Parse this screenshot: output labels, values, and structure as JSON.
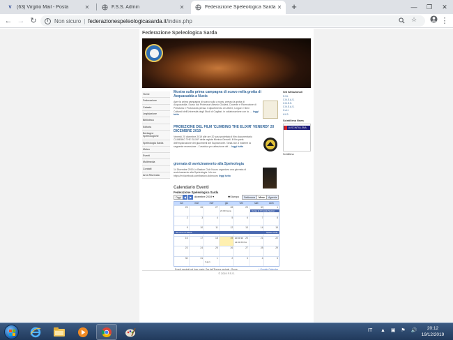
{
  "browser": {
    "tabs": [
      {
        "label": "(63) Virgilio Mail - Posta",
        "favicon": "virgilio-icon",
        "active": false
      },
      {
        "label": "F.S.S. Admin",
        "favicon": "globe-icon",
        "active": false
      },
      {
        "label": "Federazione Speleologica Sarda",
        "favicon": "globe-icon",
        "active": true
      }
    ],
    "new_tab": "+",
    "window_controls": [
      "—",
      "❐",
      "✕"
    ],
    "security_label": "Non sicuro",
    "url_separator": "|",
    "url_host": "federazionespeleologicasarda.it",
    "url_path": "/index.php"
  },
  "site": {
    "title": "Federazione Speleologica Sarda",
    "nav": [
      "Home",
      "Federazione",
      "Catasto",
      "Legislazione",
      "Biblioteca",
      "Editoria",
      "Bentagne Speleologiche",
      "Speleologia Sarda",
      "Meteo",
      "Eventi",
      "Multimedia",
      "Contatti",
      "Area Riservata"
    ],
    "articles": [
      {
        "title": "Mostra sulla prima campagna di scavo nella grotta di Acquacadda a Nuxis",
        "body": "Apre la prima campagna di scavo sulla a nuxis, presso la grotta di Acquacadda. Scavo dal Professori Alessio Giuliani, Docente e Ricercatore di Preistoria e Protostoria presso il dipartimento di Lettere, Lingue e Beni Culturali dell'Università degli Studi di Cagliari, in collaborazione con la ....",
        "more": "leggi tutto"
      },
      {
        "title": "PROIEZIONE DEL FILM 'CLIMBING THE ELIXIR' VENERDI' 20 DICEMBRE 2019",
        "body": "Venerdì 20 dicembre 2019 alle ore 20 sarà proiettato il film documentario CLIMBING THE ELIXIR della regista Monica Gerardi. Il film parla dell'esplorazione dei giacimenti del Supramonte. Tandi-rion 3 insieme la seguente recensione - L'assidua pro attrazione del ...",
        "more": "leggi tutto"
      },
      {
        "title": "giornata di avvicinamento alla Speleologia",
        "body": "14 Dicembre 2019, lo Baston Club Nuoro organizza una giornata di avvicinamento alla Speleologia. Info su: https://m.facebook.com/baston.clubnuoro",
        "more": "leggi tutto"
      }
    ],
    "right": {
      "heading": "Siti Istituzionali",
      "links": [
        "S.S.I.",
        "C.N.S.A.S.",
        "C.N.S.S.",
        "C.N.S.A.S.",
        "C.A.I.",
        "U.I.S."
      ],
      "news_heading": "Scintillena News",
      "news_banner": "LA SCINTILLENA",
      "news_footer": "Scintillena"
    }
  },
  "calendar": {
    "title": "Calendario Eventi",
    "subtitle": "Federazione Speleologica Sarda",
    "today_btn": "Oggi",
    "prev": "◀",
    "next": "▶",
    "month": "dicembre 2019 ▾",
    "print": "🖶Stampa",
    "views": [
      "Settimana",
      "Mese",
      "Agenda"
    ],
    "selected_view": "Mese",
    "weekdays": [
      "lun",
      "mar",
      "mer",
      "gio",
      "ven",
      "sab",
      "dom"
    ],
    "weeks": [
      [
        "25",
        "26",
        "27",
        "28",
        "29",
        "30",
        "1"
      ],
      [
        "2",
        "3",
        "4",
        "5",
        "6",
        "7",
        "8"
      ],
      [
        "9",
        "10",
        "11",
        "12",
        "13",
        "14",
        "15"
      ],
      [
        "16",
        "17",
        "18",
        "19",
        "20",
        "21",
        "22"
      ],
      [
        "23",
        "24",
        "25",
        "26",
        "27",
        "28",
        "29"
      ],
      [
        "30",
        "31",
        "1",
        "2",
        "3",
        "4",
        "5"
      ]
    ],
    "events": {
      "e1": "21:00 Cena",
      "e2": "Corso di IV livello Nazion",
      "e3": "20 corso di SSAS",
      "e4": "Speleo Club",
      "e5": "20:00 30",
      "e6": "21:00 XXX A",
      "e7": "1 gen"
    },
    "timezone": "Eventi mostrati nel fuso orario: Ora dell'Europa centrale - Roma",
    "gcal": "+ Google Calendar"
  },
  "footer": "© 2019 F.S.S.",
  "taskbar": {
    "lang": "IT",
    "tray": "▲ ▣ ⚑ 🔊",
    "time": "20:12",
    "date": "19/12/2019"
  }
}
